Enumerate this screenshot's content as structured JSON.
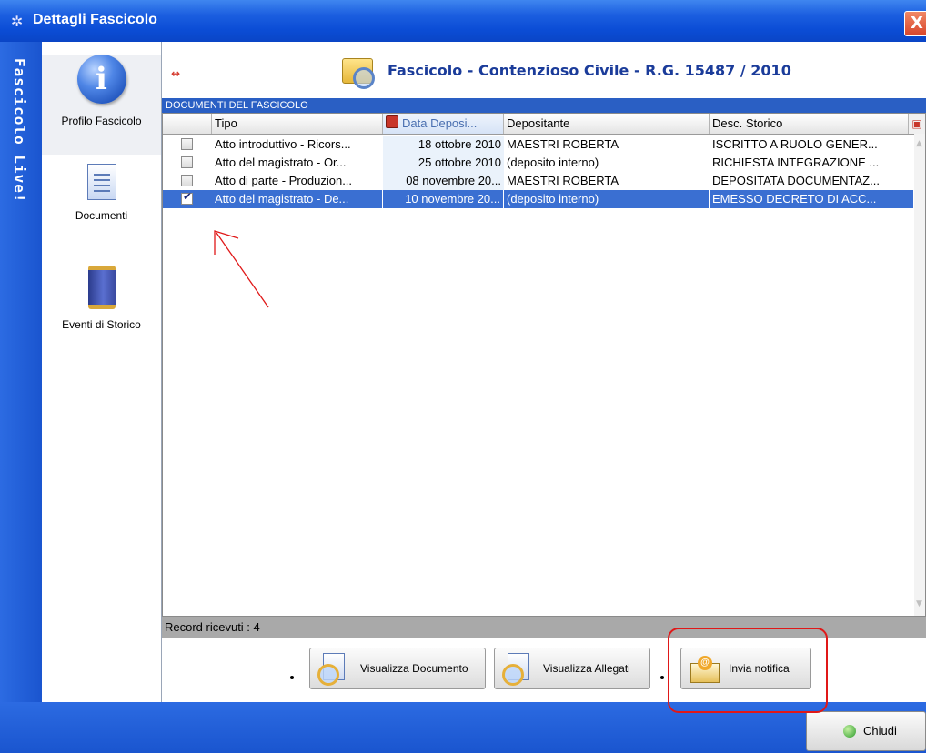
{
  "window": {
    "title": "Dettagli Fascicolo",
    "close_glyph": "X",
    "side_band_text": "Fascicolo Live!"
  },
  "nav": {
    "items": [
      {
        "label": "Profilo Fascicolo",
        "icon": "info-icon"
      },
      {
        "label": "Documenti",
        "icon": "document-icon"
      },
      {
        "label": "Eventi di Storico",
        "icon": "book-icon"
      }
    ],
    "active": "Profilo Fascicolo"
  },
  "header": {
    "title": "Fascicolo - Contenzioso Civile - R.G. 15487 / 2010",
    "collapse_glyph": "↔"
  },
  "section": {
    "label": "DOCUMENTI DEL FASCICOLO"
  },
  "table": {
    "columns": [
      "Tipo",
      "Data Deposi...",
      "Depositante",
      "Desc. Storico"
    ],
    "sorted_column": "Data Deposi...",
    "rows": [
      {
        "checked": false,
        "tipo": "Atto introduttivo - Ricors...",
        "data": "18 ottobre 2010",
        "depositante": "MAESTRI ROBERTA",
        "desc": "ISCRITTO A RUOLO GENER..."
      },
      {
        "checked": false,
        "tipo": "Atto del magistrato - Or...",
        "data": "25 ottobre 2010",
        "depositante": "(deposito interno)",
        "desc": "RICHIESTA INTEGRAZIONE ..."
      },
      {
        "checked": false,
        "tipo": "Atto di parte - Produzion...",
        "data": "08 novembre 20...",
        "depositante": "MAESTRI ROBERTA",
        "desc": "DEPOSITATA DOCUMENTAZ..."
      },
      {
        "checked": true,
        "tipo": "Atto del magistrato - De...",
        "data": "10 novembre 20...",
        "depositante": "(deposito interno)",
        "desc": "EMESSO DECRETO DI ACC..."
      }
    ],
    "selected_row": 3
  },
  "status": {
    "text": "Record ricevuti : 4"
  },
  "toolbar": {
    "view_document": "Visualizza Documento",
    "view_attachments": "Visualizza Allegati",
    "send_notification": "Invia notifica"
  },
  "footer": {
    "close_label": "Chiudi"
  },
  "colors": {
    "title_bar": "#0b4dd6",
    "selection": "#3a6fd2",
    "annotation": "#e01818",
    "title_text": "#1b3c9a"
  }
}
